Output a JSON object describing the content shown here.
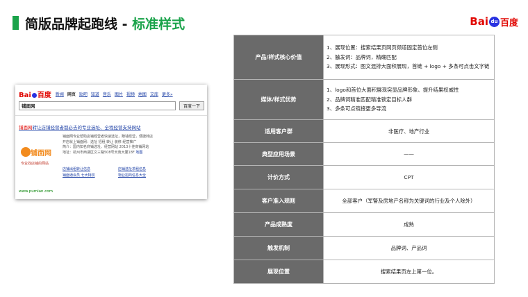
{
  "header": {
    "title_main": "简版品牌起跑线 - ",
    "title_accent": "标准样式",
    "logo_prefix": "Bai",
    "logo_paw": "du",
    "logo_suffix": "百度"
  },
  "screenshot": {
    "logo_text": "Bai",
    "logo_suffix": "百度",
    "nav": [
      "新闻",
      "网页",
      "贴吧",
      "知道",
      "音乐",
      "图片",
      "视频",
      "地图",
      "文库",
      "更多»"
    ],
    "search_value": "铺面网",
    "search_button": "百度一下",
    "headline_red": "铺面网",
    "headline_rest": "转让店铺经营者都必去的专业选址、全程经营支持网站",
    "ad_logo_word": "铺面网",
    "ad_logo_sub": "专业找店铺的网站",
    "desc_lines": [
      "铺面网专业帮助店铺经营者快速选址，赚钱经营，便捷转店",
      "开店就上铺面网：选址 招租 转让 装修 经营推广",
      "简介：国内知名商铺选址、经营网站 2013十佳商铺网站",
      "地址：杭州市西湖区文三路508号天苑大厦18F"
    ],
    "map_label": "地图",
    "links": [
      "店铺出租转让信息",
      "店铺选址求租信息",
      "铺面通会员 七大特权",
      "物业招商信息大全"
    ],
    "url": "www.pumian.com"
  },
  "table": {
    "rows": [
      {
        "key": "产品/样式核心价值",
        "values": [
          "1、展现位置：搜索结果页网页频道固定首位左侧",
          "2、触发词：品牌词，精确匹配",
          "3、展现形式：图文混排大面积展现，首链 + logo + 多条可点击文字链"
        ]
      },
      {
        "key": "媒体/样式优势",
        "values": [
          "1、logo和首位大面积展现突显品牌形象、提升结果权威性",
          "2、品牌词精准匹配精准锁定目标人群",
          "3、多条可点链接更多导流"
        ]
      },
      {
        "key": "适用客户群",
        "value": "非医疗、地产行业"
      },
      {
        "key": "典型应用场景",
        "value": "——"
      },
      {
        "key": "计价方式",
        "value": "CPT"
      },
      {
        "key": "客户准入规则",
        "value": "全部客户（军警及房地产名称为关键词的行业及个人除外）"
      },
      {
        "key": "产品成熟度",
        "value": "成熟"
      },
      {
        "key": "触发机制",
        "value": "品牌词、产品词"
      },
      {
        "key": "展现位置",
        "value": "搜索结果页左上第一位。"
      }
    ]
  }
}
